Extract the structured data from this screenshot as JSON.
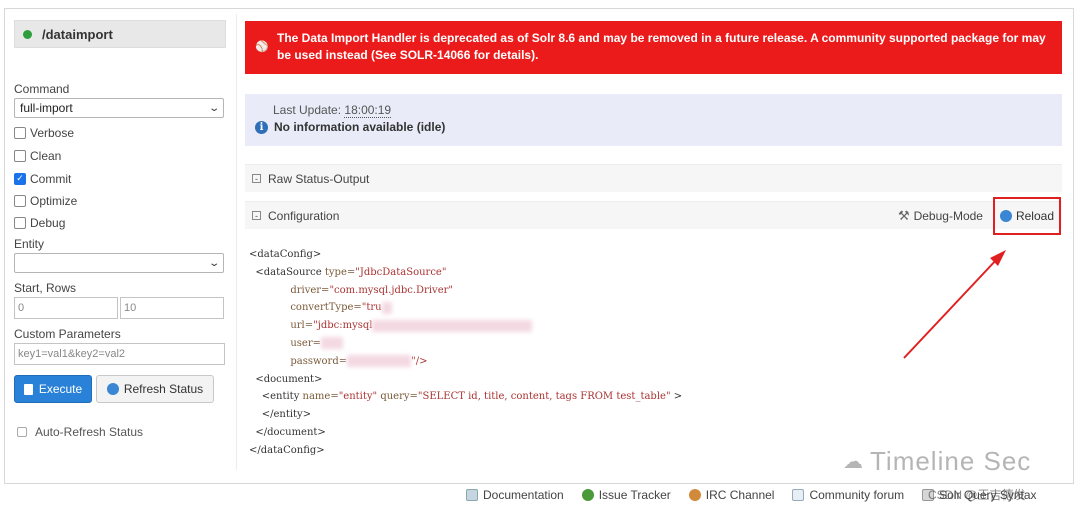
{
  "core": {
    "name": "/dataimport"
  },
  "form": {
    "command_label": "Command",
    "command_value": "full-import",
    "checkboxes": [
      {
        "label": "Verbose",
        "checked": false
      },
      {
        "label": "Clean",
        "checked": false
      },
      {
        "label": "Commit",
        "checked": true
      },
      {
        "label": "Optimize",
        "checked": false
      },
      {
        "label": "Debug",
        "checked": false
      }
    ],
    "entity_label": "Entity",
    "entity_value": "",
    "start_rows_label": "Start, Rows",
    "start_value": "0",
    "rows_value": "10",
    "custom_params_label": "Custom Parameters",
    "custom_params_value": "key1=val1&key2=val2",
    "execute_label": "Execute",
    "refresh_label": "Refresh Status",
    "auto_refresh_label": "Auto-Refresh Status"
  },
  "warning": {
    "text": "The Data Import Handler is deprecated as of Solr 8.6 and may be removed in a future release. A community supported package for may be used instead (See SOLR-14066 for details)."
  },
  "status": {
    "last_update_label": "Last Update:",
    "last_update_time": "18:00:19",
    "message": "No information available (idle)"
  },
  "sections": {
    "raw_status": "Raw Status-Output",
    "configuration": "Configuration",
    "debug_mode": "Debug-Mode",
    "reload": "Reload"
  },
  "config_lines": {
    "l1": "<dataConfig>",
    "l2a": "  <dataSource ",
    "l2b": "type=",
    "l2c": "\"JdbcDataSource\"",
    "l3b": "driver=",
    "l3c": "\"com.mysql.jdbc.Driver\"",
    "l4b": "convertType=",
    "l4c": "\"tru",
    "l5b": "url=",
    "l5c": "\"jdbc:mysql",
    "l6b": "user=",
    "l7b": "password=",
    "l7c": "\"/>",
    "l8": "  <document>",
    "l9a": "    <entity ",
    "l9b": "name=",
    "l9c": "\"entity\"",
    "l9d": " query=",
    "l9e": "\"SELECT id, title, content, tags FROM test_table\"",
    "l9f": " >",
    "l10": "    </entity>",
    "l11": "  </document>",
    "l12": "</dataConfig>"
  },
  "footer": {
    "documentation": "Documentation",
    "issue_tracker": "Issue Tracker",
    "irc_channel": "IRC Channel",
    "community_forum": "Community forum",
    "query_syntax": "Solr Query Syntax"
  },
  "watermark": {
    "main": "Timeline Sec",
    "small": "CSDN @王吉德发"
  }
}
